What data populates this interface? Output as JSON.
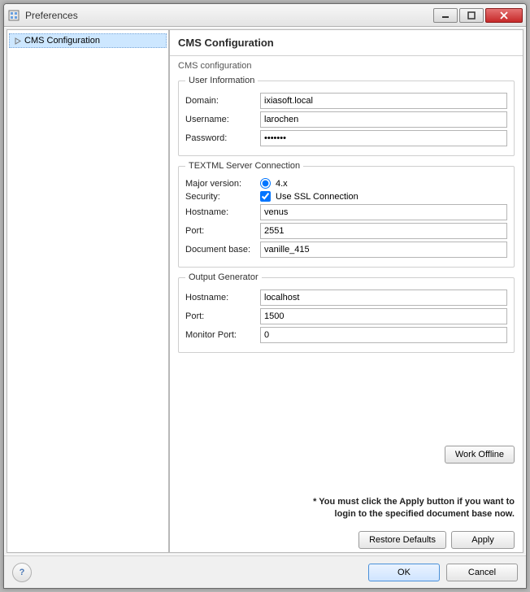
{
  "window": {
    "title": "Preferences"
  },
  "tree": {
    "items": [
      {
        "label": "CMS Configuration",
        "selected": true
      }
    ]
  },
  "page": {
    "title": "CMS Configuration",
    "section_label": "CMS configuration",
    "user_info": {
      "legend": "User Information",
      "domain_label": "Domain:",
      "domain_value": "ixiasoft.local",
      "username_label": "Username:",
      "username_value": "larochen",
      "password_label": "Password:",
      "password_value": "•••••••"
    },
    "textml": {
      "legend": "TEXTML Server Connection",
      "major_version_label": "Major version:",
      "major_version_option": "4.x",
      "security_label": "Security:",
      "ssl_label": "Use SSL Connection",
      "ssl_checked": true,
      "hostname_label": "Hostname:",
      "hostname_value": "venus",
      "port_label": "Port:",
      "port_value": "2551",
      "docbase_label": "Document base:",
      "docbase_value": "vanille_415"
    },
    "output": {
      "legend": "Output Generator",
      "hostname_label": "Hostname:",
      "hostname_value": "localhost",
      "port_label": "Port:",
      "port_value": "1500",
      "monitor_port_label": "Monitor Port:",
      "monitor_port_value": "0"
    },
    "work_offline_label": "Work Offline",
    "note_line1": "* You must click the Apply button if you want to",
    "note_line2": "login to the specified document base now.",
    "restore_defaults_label": "Restore Defaults",
    "apply_label": "Apply"
  },
  "footer": {
    "help_tooltip": "Help",
    "ok_label": "OK",
    "cancel_label": "Cancel"
  }
}
